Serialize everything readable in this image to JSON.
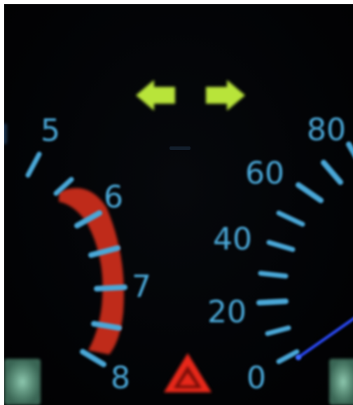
{
  "colors": {
    "background": "#020305",
    "gauge_blue": "#4aa8d8",
    "redline": "#e0321e",
    "indicator_green": "#b8e43a",
    "hazard_red": "#e8281a",
    "needle": "#2b4cff",
    "corner_lamp": "#7fc7a8"
  },
  "icons": {
    "left_indicator": "arrow-left-icon",
    "right_indicator": "arrow-right-icon",
    "hazard": "hazard-warning-triangle-icon"
  },
  "tachometer": {
    "labels": [
      "5",
      "6",
      "7",
      "8"
    ]
  },
  "speedometer": {
    "labels": [
      "0",
      "20",
      "40",
      "60",
      "80"
    ]
  }
}
